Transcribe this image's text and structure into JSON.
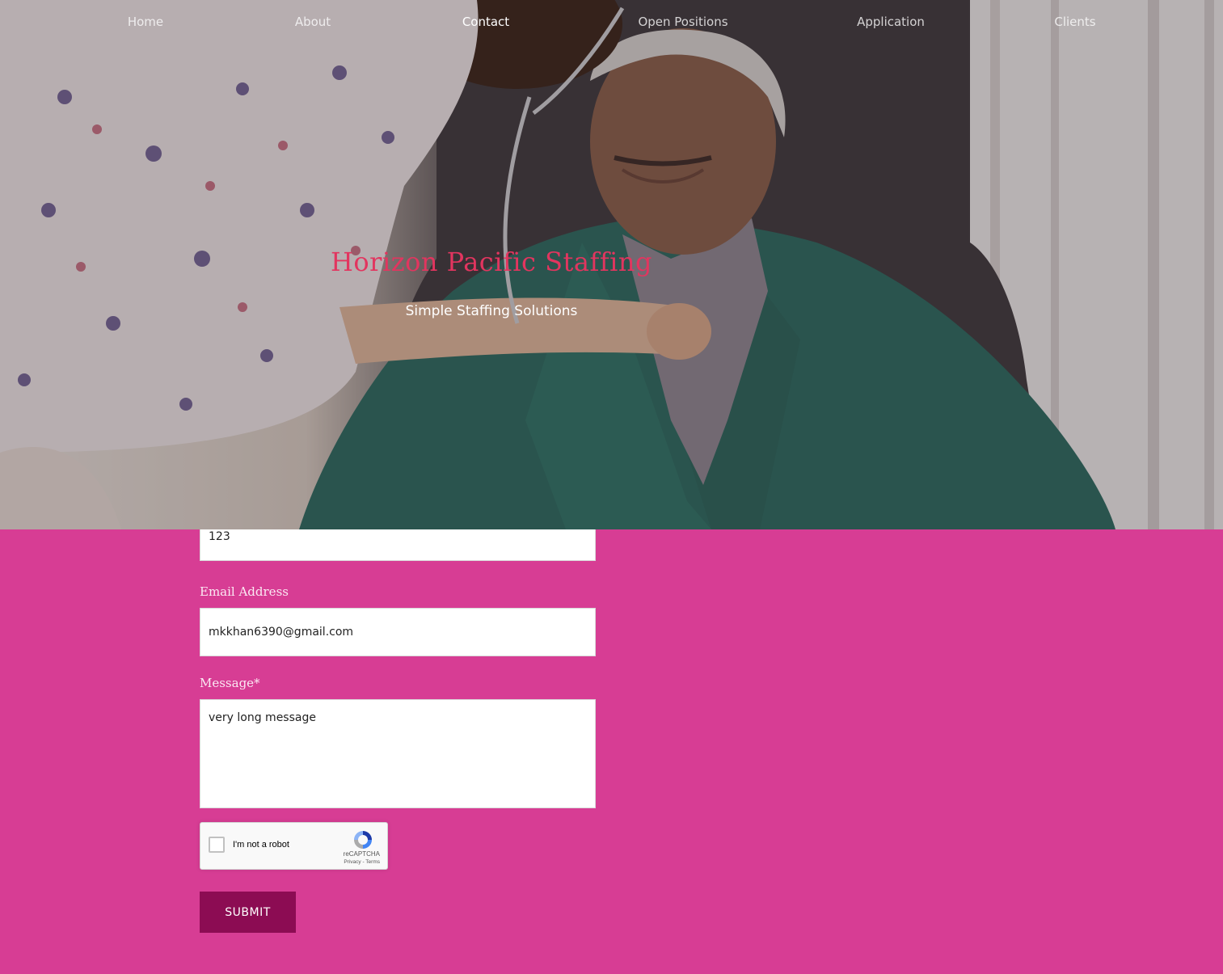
{
  "nav": {
    "items": [
      {
        "label": "Home"
      },
      {
        "label": "About"
      },
      {
        "label": "Contact",
        "active": true
      },
      {
        "label": "Open Positions"
      },
      {
        "label": "Application"
      },
      {
        "label": "Clients"
      }
    ]
  },
  "hero": {
    "title": "Horizon Pacific Staffing",
    "subtitle": "Simple Staffing Solutions"
  },
  "form": {
    "phone_value": "123",
    "email_label": "Email Address",
    "email_value": "mkkhan6390@gmail.com",
    "message_label": "Message*",
    "message_value": "very long message",
    "captcha": {
      "label": "I'm not a robot",
      "brand": "reCAPTCHA",
      "links": "Privacy - Terms"
    },
    "submit_label": "SUBMIT"
  },
  "colors": {
    "page_bg": "#d73d94",
    "title": "#e2355f",
    "submit_bg": "#8c0c53"
  }
}
